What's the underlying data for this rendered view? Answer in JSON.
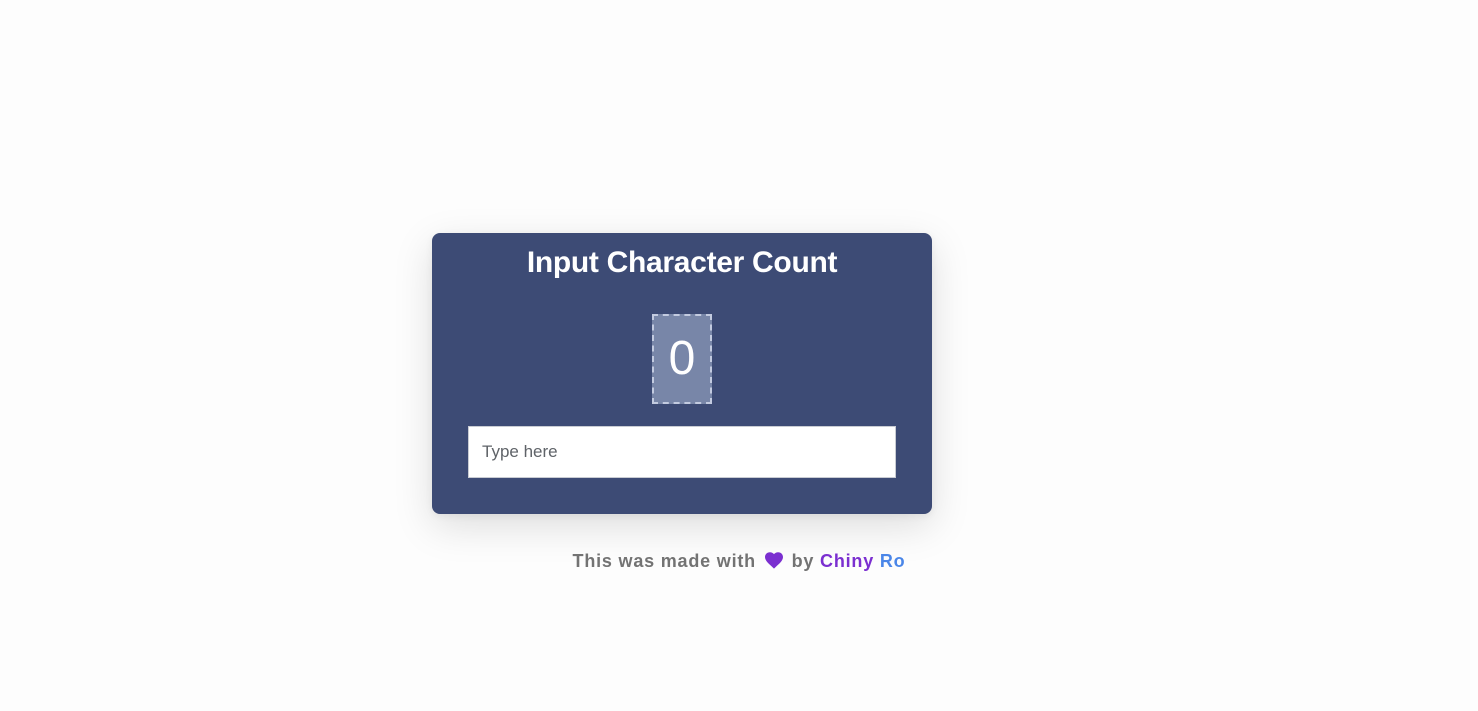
{
  "card": {
    "title": "Input Character Count",
    "count": "0",
    "input": {
      "value": "",
      "placeholder": "Type here"
    }
  },
  "footer": {
    "prefix": "This was made with",
    "icon": "heart-icon",
    "by": "by",
    "author_first": "Chiny",
    "author_last": "Ro"
  },
  "colors": {
    "page_background": "#fdfdfd",
    "card_background": "#3d4b75",
    "count_box_background": "#7886a8",
    "heart": "#7b2fd0",
    "author_first": "#7b2fd0",
    "author_last": "#4a86e8"
  }
}
